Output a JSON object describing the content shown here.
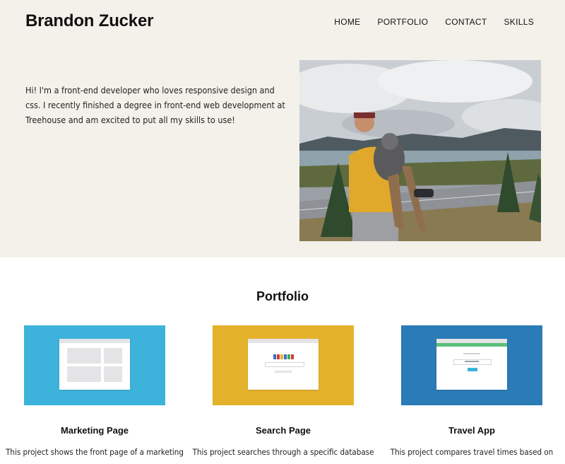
{
  "header": {
    "site_title": "Brandon Zucker",
    "nav": [
      "HOME",
      "PORTFOLIO",
      "CONTACT",
      "SKILLS"
    ]
  },
  "hero": {
    "intro": "Hi! I'm a front-end developer who loves responsive design and css. I recently finished a degree in front-end web development at Treehouse and am excited to put all my skills to use!",
    "photo_label": "photo of man holding dog outdoors"
  },
  "portfolio": {
    "heading": "Portfolio",
    "projects": [
      {
        "title": "Marketing Page",
        "desc": "This project shows the front page of a marketing",
        "color": "#3db3db"
      },
      {
        "title": "Search Page",
        "desc": "This project searches through a specific database",
        "color": "#e4b12a"
      },
      {
        "title": "Travel App",
        "desc": "This project compares travel times based on",
        "color": "#2b7bb6"
      }
    ]
  }
}
